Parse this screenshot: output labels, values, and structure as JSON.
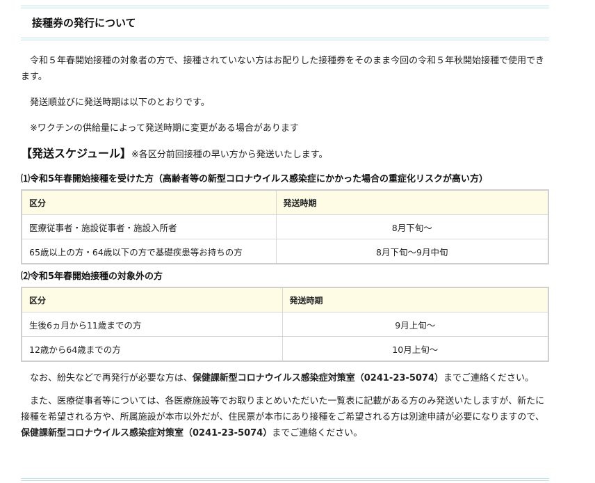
{
  "section": {
    "heading": "接種券の発行について"
  },
  "paragraphs": {
    "p1": "令和５年春開始接種の対象者の方で、接種されていない方はお配りした接種券をそのまま今回の令和５年秋開始接種で使用できます。",
    "p2": "発送順並びに発送時期は以下のとおりです。",
    "p3": "※ワクチンの供給量によって発送時期に変更がある場合があります"
  },
  "schedule": {
    "title": "【発送スケジュール】",
    "note": "※各区分前回接種の早い方から発送いたします。"
  },
  "table1": {
    "caption": "⑴令和5年春開始接種を受けた方（高齢者等の新型コロナウイルス感染症にかかった場合の重症化リスクが高い方）",
    "headers": [
      "区分",
      "発送時期"
    ],
    "rows": [
      [
        "医療従事者・施設従事者・施設入所者",
        "8月下旬～"
      ],
      [
        "65歳以上の方・64歳以下の方で基礎疾患等お持ちの方",
        "8月下旬～9月中旬"
      ]
    ]
  },
  "table2": {
    "caption": "⑵令和5年春開始接種の対象外の方",
    "headers": [
      "区分",
      "発送時期"
    ],
    "rows": [
      [
        "生後6ヵ月から11歳までの方",
        "9月上旬～"
      ],
      [
        "12歳から64歳までの方",
        "10月上旬～"
      ]
    ]
  },
  "contact": {
    "p4_before": "なお、紛失などで再発行が必要な方は、",
    "p4_bold": "保健課新型コロナウイルス感染症対策室（0241-23-5074）",
    "p4_after": "までご連絡ください。",
    "p5_before": "また、医療従事者等については、各医療施設等でお取りまとめいただいた一覧表に記載がある方のみ発送いたしますが、新たに接種を希望される方や、所属施設が本市以外だが、住民票が本市にあり接種をご希望される方は別途申請が必要になりますので、",
    "p5_bold": "保健課新型コロナウイルス感染症対策室（0241-23-5074）",
    "p5_after": "までご連絡ください。"
  }
}
